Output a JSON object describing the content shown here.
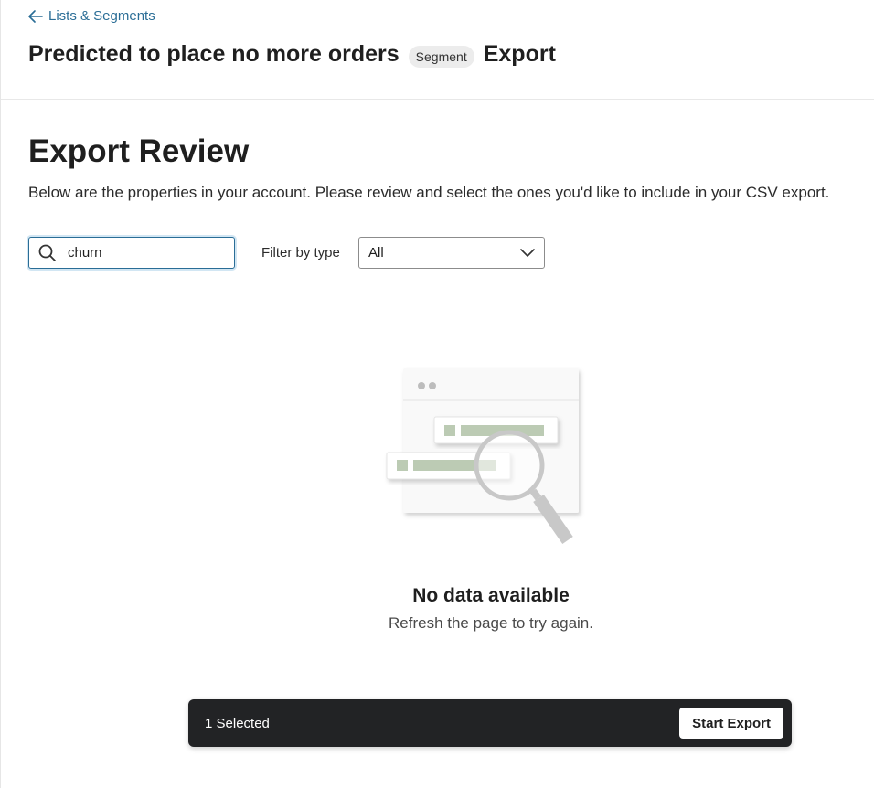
{
  "header": {
    "back_label": "Lists & Segments",
    "title": "Predicted to place no more orders",
    "badge": "Segment",
    "title_suffix": "Export"
  },
  "main": {
    "title": "Export Review",
    "description": "Below are the properties in your account. Please review and select the ones you'd like to include in your CSV export."
  },
  "search": {
    "value": "churn",
    "placeholder": ""
  },
  "filter": {
    "label": "Filter by type",
    "selected": "All"
  },
  "empty_state": {
    "title": "No data available",
    "subtitle": "Refresh the page to try again."
  },
  "action_bar": {
    "selected_text": "1 Selected",
    "button_label": "Start Export"
  },
  "colors": {
    "link": "#2a6d96",
    "action_bar_bg": "#222325",
    "illustration_green": "#bccbb4"
  }
}
